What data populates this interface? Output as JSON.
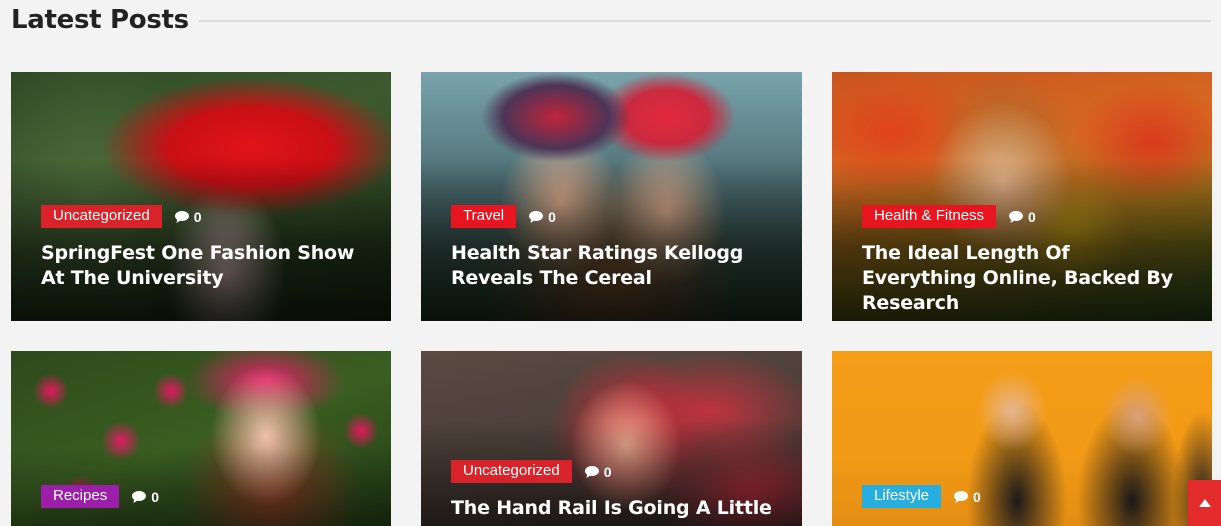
{
  "section": {
    "title": "Latest Posts"
  },
  "colors": {
    "uncategorized": "#d8232a",
    "travel": "#e8141f",
    "health": "#e8141f",
    "recipes": "#9b1fa8",
    "lifestyle": "#27aee0",
    "scroll_top": "#e32b2b"
  },
  "posts": [
    {
      "category": "Uncategorized",
      "comments": "0",
      "title": "SpringFest One Fashion Show At The University"
    },
    {
      "category": "Travel",
      "comments": "0",
      "title": "Health Star Ratings Kellogg Reveals The Cereal"
    },
    {
      "category": "Health & Fitness",
      "comments": "0",
      "title": "The Ideal Length Of Everything Online, Backed By Research"
    },
    {
      "category": "Recipes",
      "comments": "0",
      "title": ""
    },
    {
      "category": "Uncategorized",
      "comments": "0",
      "title": "The Hand Rail Is Going A Little"
    },
    {
      "category": "Lifestyle",
      "comments": "0",
      "title": ""
    }
  ],
  "icons": {
    "comment": "comment-icon",
    "scroll_top": "chevron-up-icon"
  }
}
